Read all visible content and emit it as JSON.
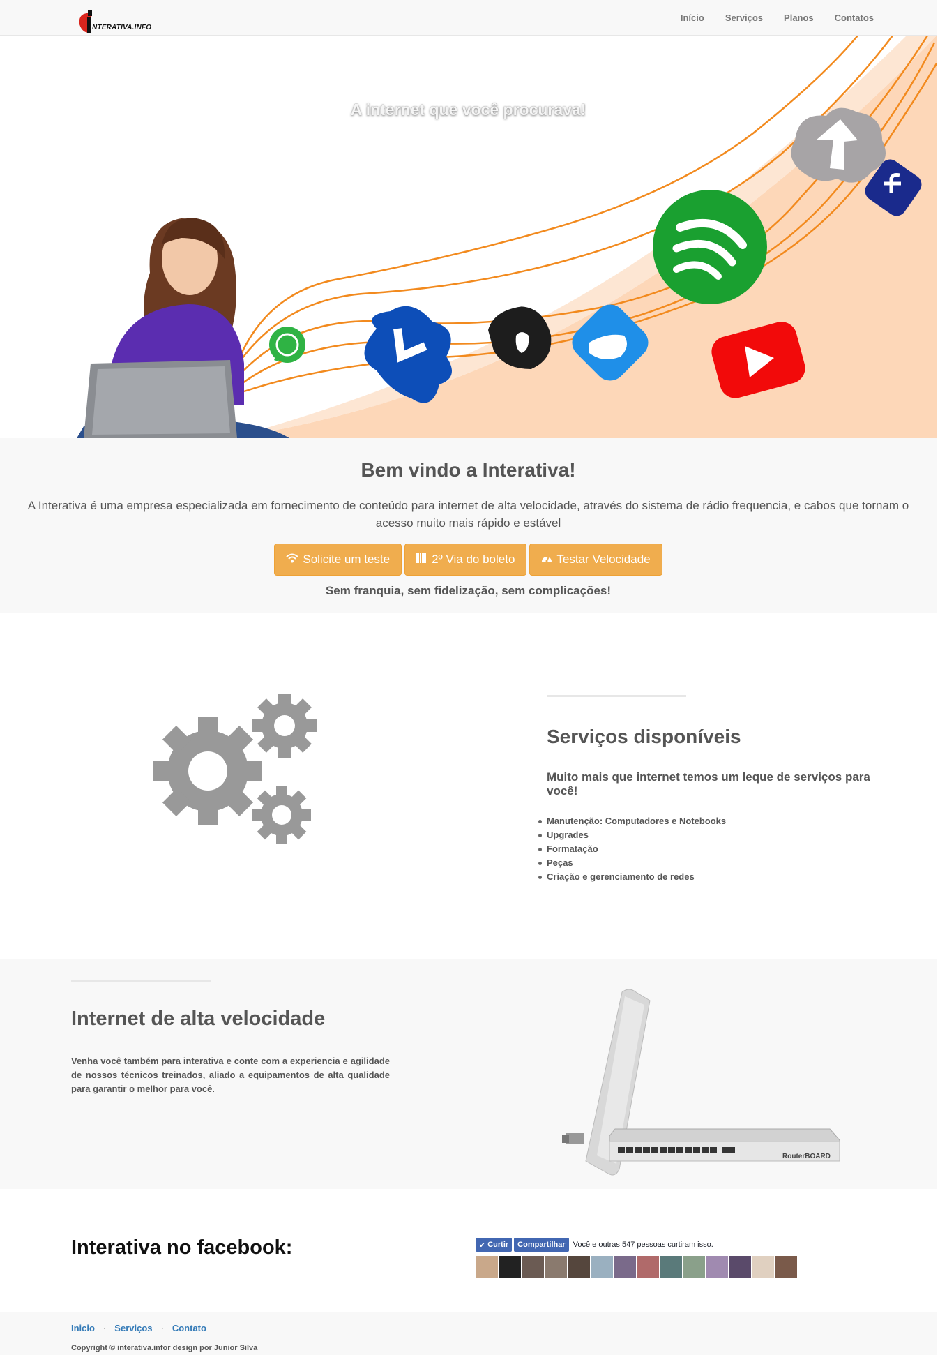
{
  "nav": {
    "logo_text": "NTERATIVA.INFO",
    "items": [
      {
        "label": "Início"
      },
      {
        "label": "Serviços"
      },
      {
        "label": "Planos"
      },
      {
        "label": "Contatos"
      }
    ]
  },
  "hero": {
    "title": "A internet que você procurava!"
  },
  "welcome": {
    "title": "Bem vindo a Interativa!",
    "text": "A Interativa é uma empresa especializada em fornecimento de conteúdo para internet de alta velocidade, através do sistema de rádio frequencia, e cabos que tornam o acesso muito mais rápido e estável",
    "buttons": [
      {
        "label": "Solicite um teste",
        "icon": "wifi-icon"
      },
      {
        "label": "2º Via do boleto",
        "icon": "barcode-icon"
      },
      {
        "label": "Testar Velocidade",
        "icon": "dashboard-icon"
      }
    ],
    "tagline": "Sem franquia, sem fidelização, sem complicações!"
  },
  "services": {
    "title": "Serviços disponíveis",
    "subtitle": "Muito mais que internet temos um leque de serviços para você!",
    "items": [
      "Manutenção: Computadores e Notebooks",
      "Upgrades",
      "Formatação",
      "Peças",
      "Criação e gerenciamento de redes"
    ]
  },
  "internet": {
    "title": "Internet de alta velocidade",
    "text": "Venha você também para interativa e conte com a experiencia e agilidade de nossos técnicos treinados, aliado a equipamentos de alta qualidade para garantir o melhor para você.",
    "router_label": "RouterBOARD"
  },
  "facebook": {
    "title": "Interativa no facebook:",
    "like_label": "Curtir",
    "share_label": "Compartilhar",
    "count_text": "Você e outras 547 pessoas curtiram isso."
  },
  "footer": {
    "links": [
      {
        "label": "Inicio"
      },
      {
        "label": "Serviços"
      },
      {
        "label": "Contato"
      }
    ],
    "copyright": "Copyright © interativa.infor design por Junior Silva"
  },
  "colors": {
    "accent": "#f0ad4e",
    "link": "#337ab7",
    "facebook": "#4267b2",
    "hero_curve": "#fdd7b8"
  }
}
